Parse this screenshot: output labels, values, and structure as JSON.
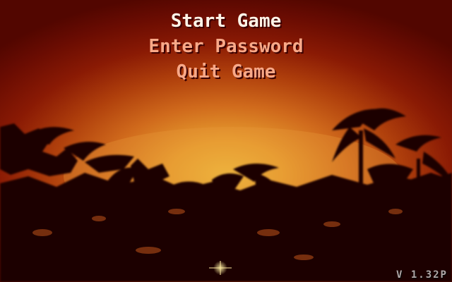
{
  "menu": {
    "start_label": "Start Game",
    "password_label": "Enter Password",
    "quit_label": "Quit Game",
    "selected_color": "#fff4e8",
    "unselected_color": "#f8a888"
  },
  "version": "V 1.32P",
  "scene": {
    "sky_colors": [
      "#520600",
      "#8a1a04",
      "#d06a1c",
      "#f0c040"
    ],
    "silhouette_color": "#1a0000"
  }
}
